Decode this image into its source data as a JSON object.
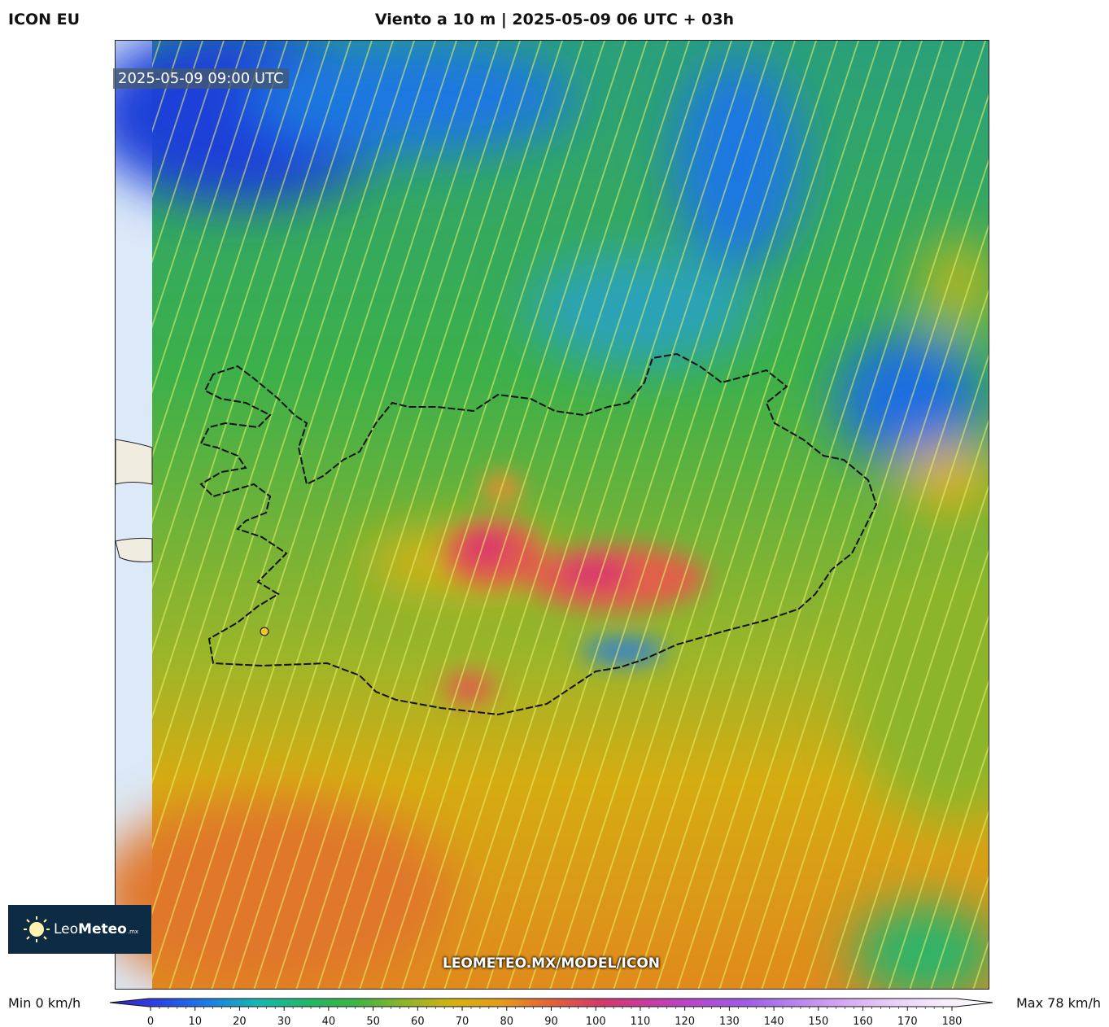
{
  "model": "ICON EU",
  "title": "Viento a 10 m | 2025-05-09 06 UTC + 03h",
  "timestamp": "2025-05-09 09:00 UTC",
  "watermark": "LEOMETEO.MX/MODEL/ICON",
  "logo": {
    "text_light": "Leo",
    "text_bold": "Meteo",
    "suffix": ".mx"
  },
  "legend": {
    "min": "Min 0 km/h",
    "max": "Max 78 km/h",
    "ticks": [
      "0",
      "10",
      "20",
      "30",
      "40",
      "50",
      "60",
      "70",
      "80",
      "90",
      "100",
      "110",
      "120",
      "130",
      "140",
      "150",
      "160",
      "170",
      "180"
    ],
    "colors": [
      "#3a1fc8",
      "#2a44e0",
      "#1d7de6",
      "#17b7b0",
      "#1fb86a",
      "#3db445",
      "#8cb52a",
      "#d5b212",
      "#e69a1c",
      "#e2623a",
      "#d43a6a",
      "#c83aa0",
      "#b34ad0",
      "#9f5ce6",
      "#b985ee",
      "#d6a9f3",
      "#ead0f8",
      "#f6ecfc",
      "#ffffff"
    ]
  }
}
